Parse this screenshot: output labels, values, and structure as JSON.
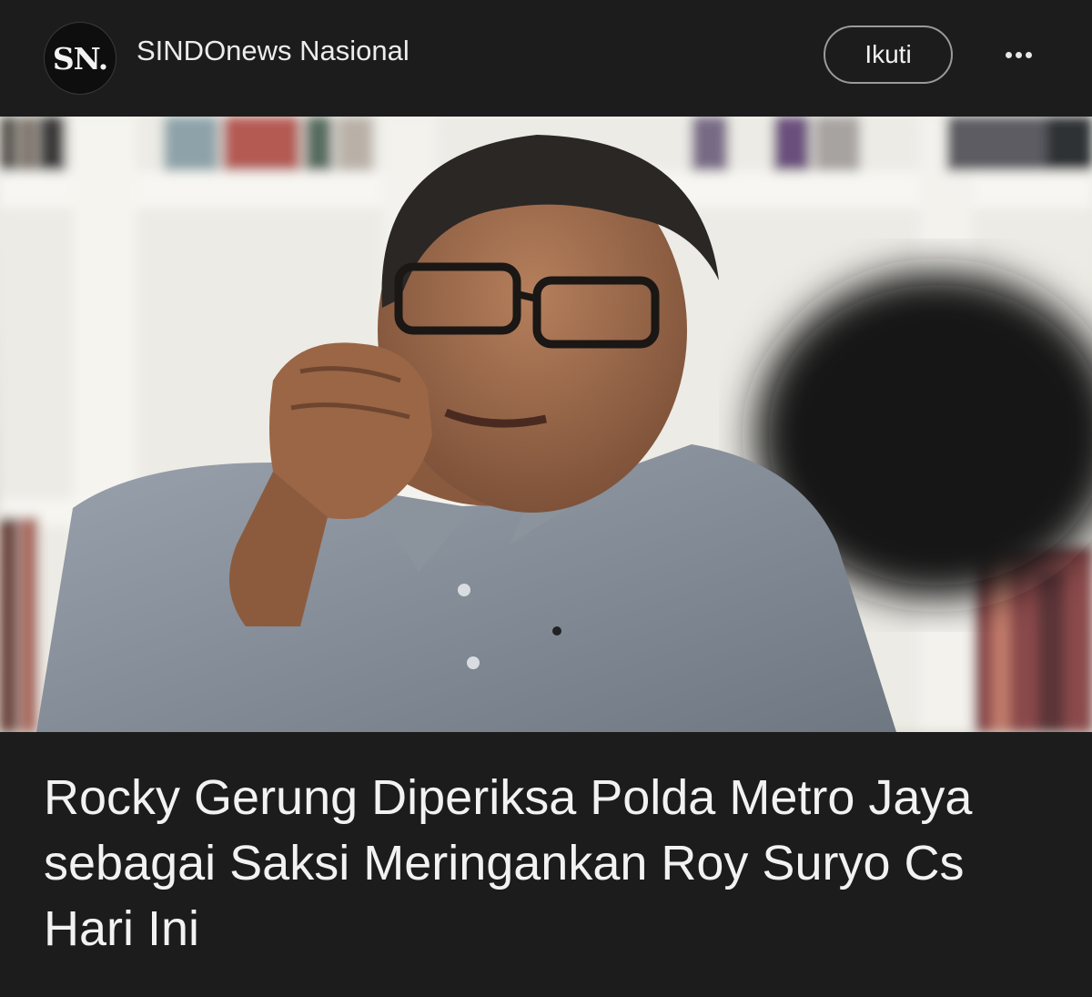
{
  "header": {
    "logo_text": "SN.",
    "source_name": "SINDOnews Nasional",
    "follow_label": "Ikuti",
    "more_icon": "more-horizontal-icon"
  },
  "article": {
    "headline": "Rocky Gerung Diperiksa Polda Metro Jaya sebagai Saksi Meringankan Roy Suryo Cs Hari Ini"
  },
  "colors": {
    "background": "#1c1c1c",
    "text": "#f1f1f1",
    "button_border": "#9a9a9a"
  }
}
